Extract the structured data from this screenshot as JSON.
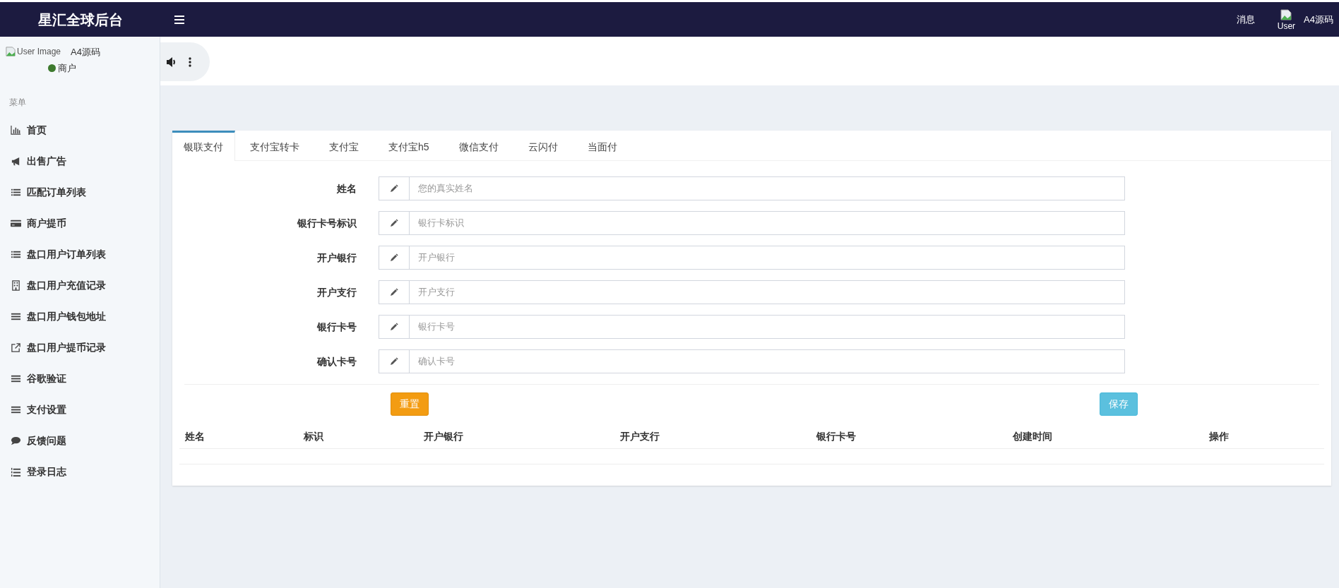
{
  "brand": "星汇全球后台",
  "header": {
    "messages": "消息",
    "user_image_alt": "User",
    "user_name": "A4源码"
  },
  "user_panel": {
    "image_alt": "User Image",
    "name": "A4源码",
    "status": "商户",
    "online": true
  },
  "sidebar": {
    "header": "菜单",
    "items": [
      {
        "label": "首页"
      },
      {
        "label": "出售广告"
      },
      {
        "label": "匹配订单列表"
      },
      {
        "label": "商户提币"
      },
      {
        "label": "盘口用户订单列表"
      },
      {
        "label": "盘口用户充值记录"
      },
      {
        "label": "盘口用户钱包地址"
      },
      {
        "label": "盘口用户提币记录"
      },
      {
        "label": "谷歌验证"
      },
      {
        "label": "支付设置"
      },
      {
        "label": "反馈问题"
      },
      {
        "label": "登录日志"
      }
    ]
  },
  "tabs": [
    {
      "label": "银联支付",
      "selected": true
    },
    {
      "label": "支付宝转卡",
      "selected": false
    },
    {
      "label": "支付宝",
      "selected": false
    },
    {
      "label": "支付宝h5",
      "selected": false
    },
    {
      "label": "微信支付",
      "selected": false
    },
    {
      "label": "云闪付",
      "selected": false
    },
    {
      "label": "当面付",
      "selected": false
    }
  ],
  "form": {
    "fields": [
      {
        "label": "姓名",
        "placeholder": "您的真实姓名"
      },
      {
        "label": "银行卡号标识",
        "placeholder": "银行卡标识"
      },
      {
        "label": "开户银行",
        "placeholder": "开户银行"
      },
      {
        "label": "开户支行",
        "placeholder": "开户支行"
      },
      {
        "label": "银行卡号",
        "placeholder": "银行卡号"
      },
      {
        "label": "确认卡号",
        "placeholder": "确认卡号"
      }
    ],
    "buttons": [
      {
        "label": "重置",
        "kind": "warning"
      },
      {
        "label": "保存",
        "kind": "info"
      }
    ]
  },
  "table": {
    "columns": [
      "姓名",
      "标识",
      "开户银行",
      "开户支行",
      "银行卡号",
      "创建时间",
      "操作"
    ]
  }
}
